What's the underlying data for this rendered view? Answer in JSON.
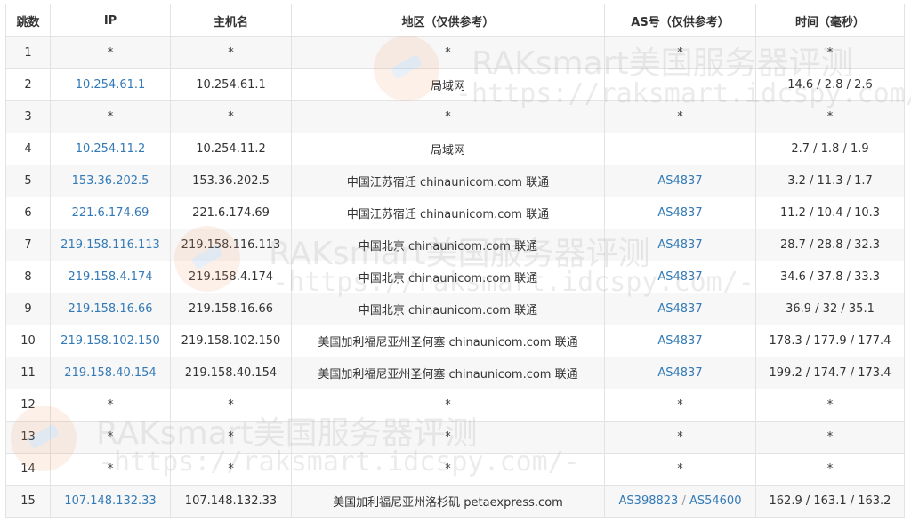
{
  "columns": [
    "跳数",
    "IP",
    "主机名",
    "地区（仅供参考）",
    "AS号（仅供参考）",
    "时间（毫秒）"
  ],
  "hops": [
    {
      "hop": "1",
      "ip": "*",
      "ip_link": false,
      "host": "*",
      "region": "*",
      "as": [
        "*"
      ],
      "as_link": false,
      "time": "*"
    },
    {
      "hop": "2",
      "ip": "10.254.61.1",
      "ip_link": true,
      "host": "10.254.61.1",
      "region": "局域网",
      "as": [],
      "as_link": false,
      "time": "14.6 / 2.8 / 2.6"
    },
    {
      "hop": "3",
      "ip": "*",
      "ip_link": false,
      "host": "*",
      "region": "*",
      "as": [
        "*"
      ],
      "as_link": false,
      "time": "*"
    },
    {
      "hop": "4",
      "ip": "10.254.11.2",
      "ip_link": true,
      "host": "10.254.11.2",
      "region": "局域网",
      "as": [],
      "as_link": false,
      "time": "2.7 / 1.8 / 1.9"
    },
    {
      "hop": "5",
      "ip": "153.36.202.5",
      "ip_link": true,
      "host": "153.36.202.5",
      "region": "中国江苏宿迁 chinaunicom.com 联通",
      "as": [
        "AS4837"
      ],
      "as_link": true,
      "time": "3.2 / 11.3 / 1.7"
    },
    {
      "hop": "6",
      "ip": "221.6.174.69",
      "ip_link": true,
      "host": "221.6.174.69",
      "region": "中国江苏宿迁 chinaunicom.com 联通",
      "as": [
        "AS4837"
      ],
      "as_link": true,
      "time": "11.2 / 10.4 / 10.3"
    },
    {
      "hop": "7",
      "ip": "219.158.116.113",
      "ip_link": true,
      "host": "219.158.116.113",
      "region": "中国北京 chinaunicom.com 联通",
      "as": [
        "AS4837"
      ],
      "as_link": true,
      "time": "28.7 / 28.8 / 32.3"
    },
    {
      "hop": "8",
      "ip": "219.158.4.174",
      "ip_link": true,
      "host": "219.158.4.174",
      "region": "中国北京 chinaunicom.com 联通",
      "as": [
        "AS4837"
      ],
      "as_link": true,
      "time": "34.6 / 37.8 / 33.3"
    },
    {
      "hop": "9",
      "ip": "219.158.16.66",
      "ip_link": true,
      "host": "219.158.16.66",
      "region": "中国北京 chinaunicom.com 联通",
      "as": [
        "AS4837"
      ],
      "as_link": true,
      "time": "36.9 / 32 / 35.1"
    },
    {
      "hop": "10",
      "ip": "219.158.102.150",
      "ip_link": true,
      "host": "219.158.102.150",
      "region": "美国加利福尼亚州圣何塞 chinaunicom.com 联通",
      "as": [
        "AS4837"
      ],
      "as_link": true,
      "time": "178.3 / 177.9 / 177.4"
    },
    {
      "hop": "11",
      "ip": "219.158.40.154",
      "ip_link": true,
      "host": "219.158.40.154",
      "region": "美国加利福尼亚州圣何塞 chinaunicom.com 联通",
      "as": [
        "AS4837"
      ],
      "as_link": true,
      "time": "199.2 / 174.7 / 173.4"
    },
    {
      "hop": "12",
      "ip": "*",
      "ip_link": false,
      "host": "*",
      "region": "*",
      "as": [
        "*"
      ],
      "as_link": false,
      "time": "*"
    },
    {
      "hop": "13",
      "ip": "*",
      "ip_link": false,
      "host": "*",
      "region": "*",
      "as": [
        "*"
      ],
      "as_link": false,
      "time": "*"
    },
    {
      "hop": "14",
      "ip": "*",
      "ip_link": false,
      "host": "*",
      "region": "*",
      "as": [
        "*"
      ],
      "as_link": false,
      "time": "*"
    },
    {
      "hop": "15",
      "ip": "107.148.132.33",
      "ip_link": true,
      "host": "107.148.132.33",
      "region": "美国加利福尼亚州洛杉矶 petaexpress.com",
      "as": [
        "AS398823",
        "AS54600"
      ],
      "as_link": true,
      "time": "162.9 / 163.1 / 163.2"
    }
  ],
  "watermark": {
    "line1": "RAKsmart美国服务器评测",
    "line2": "-https://raksmart.idcspy.com/-"
  },
  "colors": {
    "link": "#337ab7",
    "border": "#e3e3e3",
    "stripe": "#f7f7f7",
    "text": "#333333"
  }
}
